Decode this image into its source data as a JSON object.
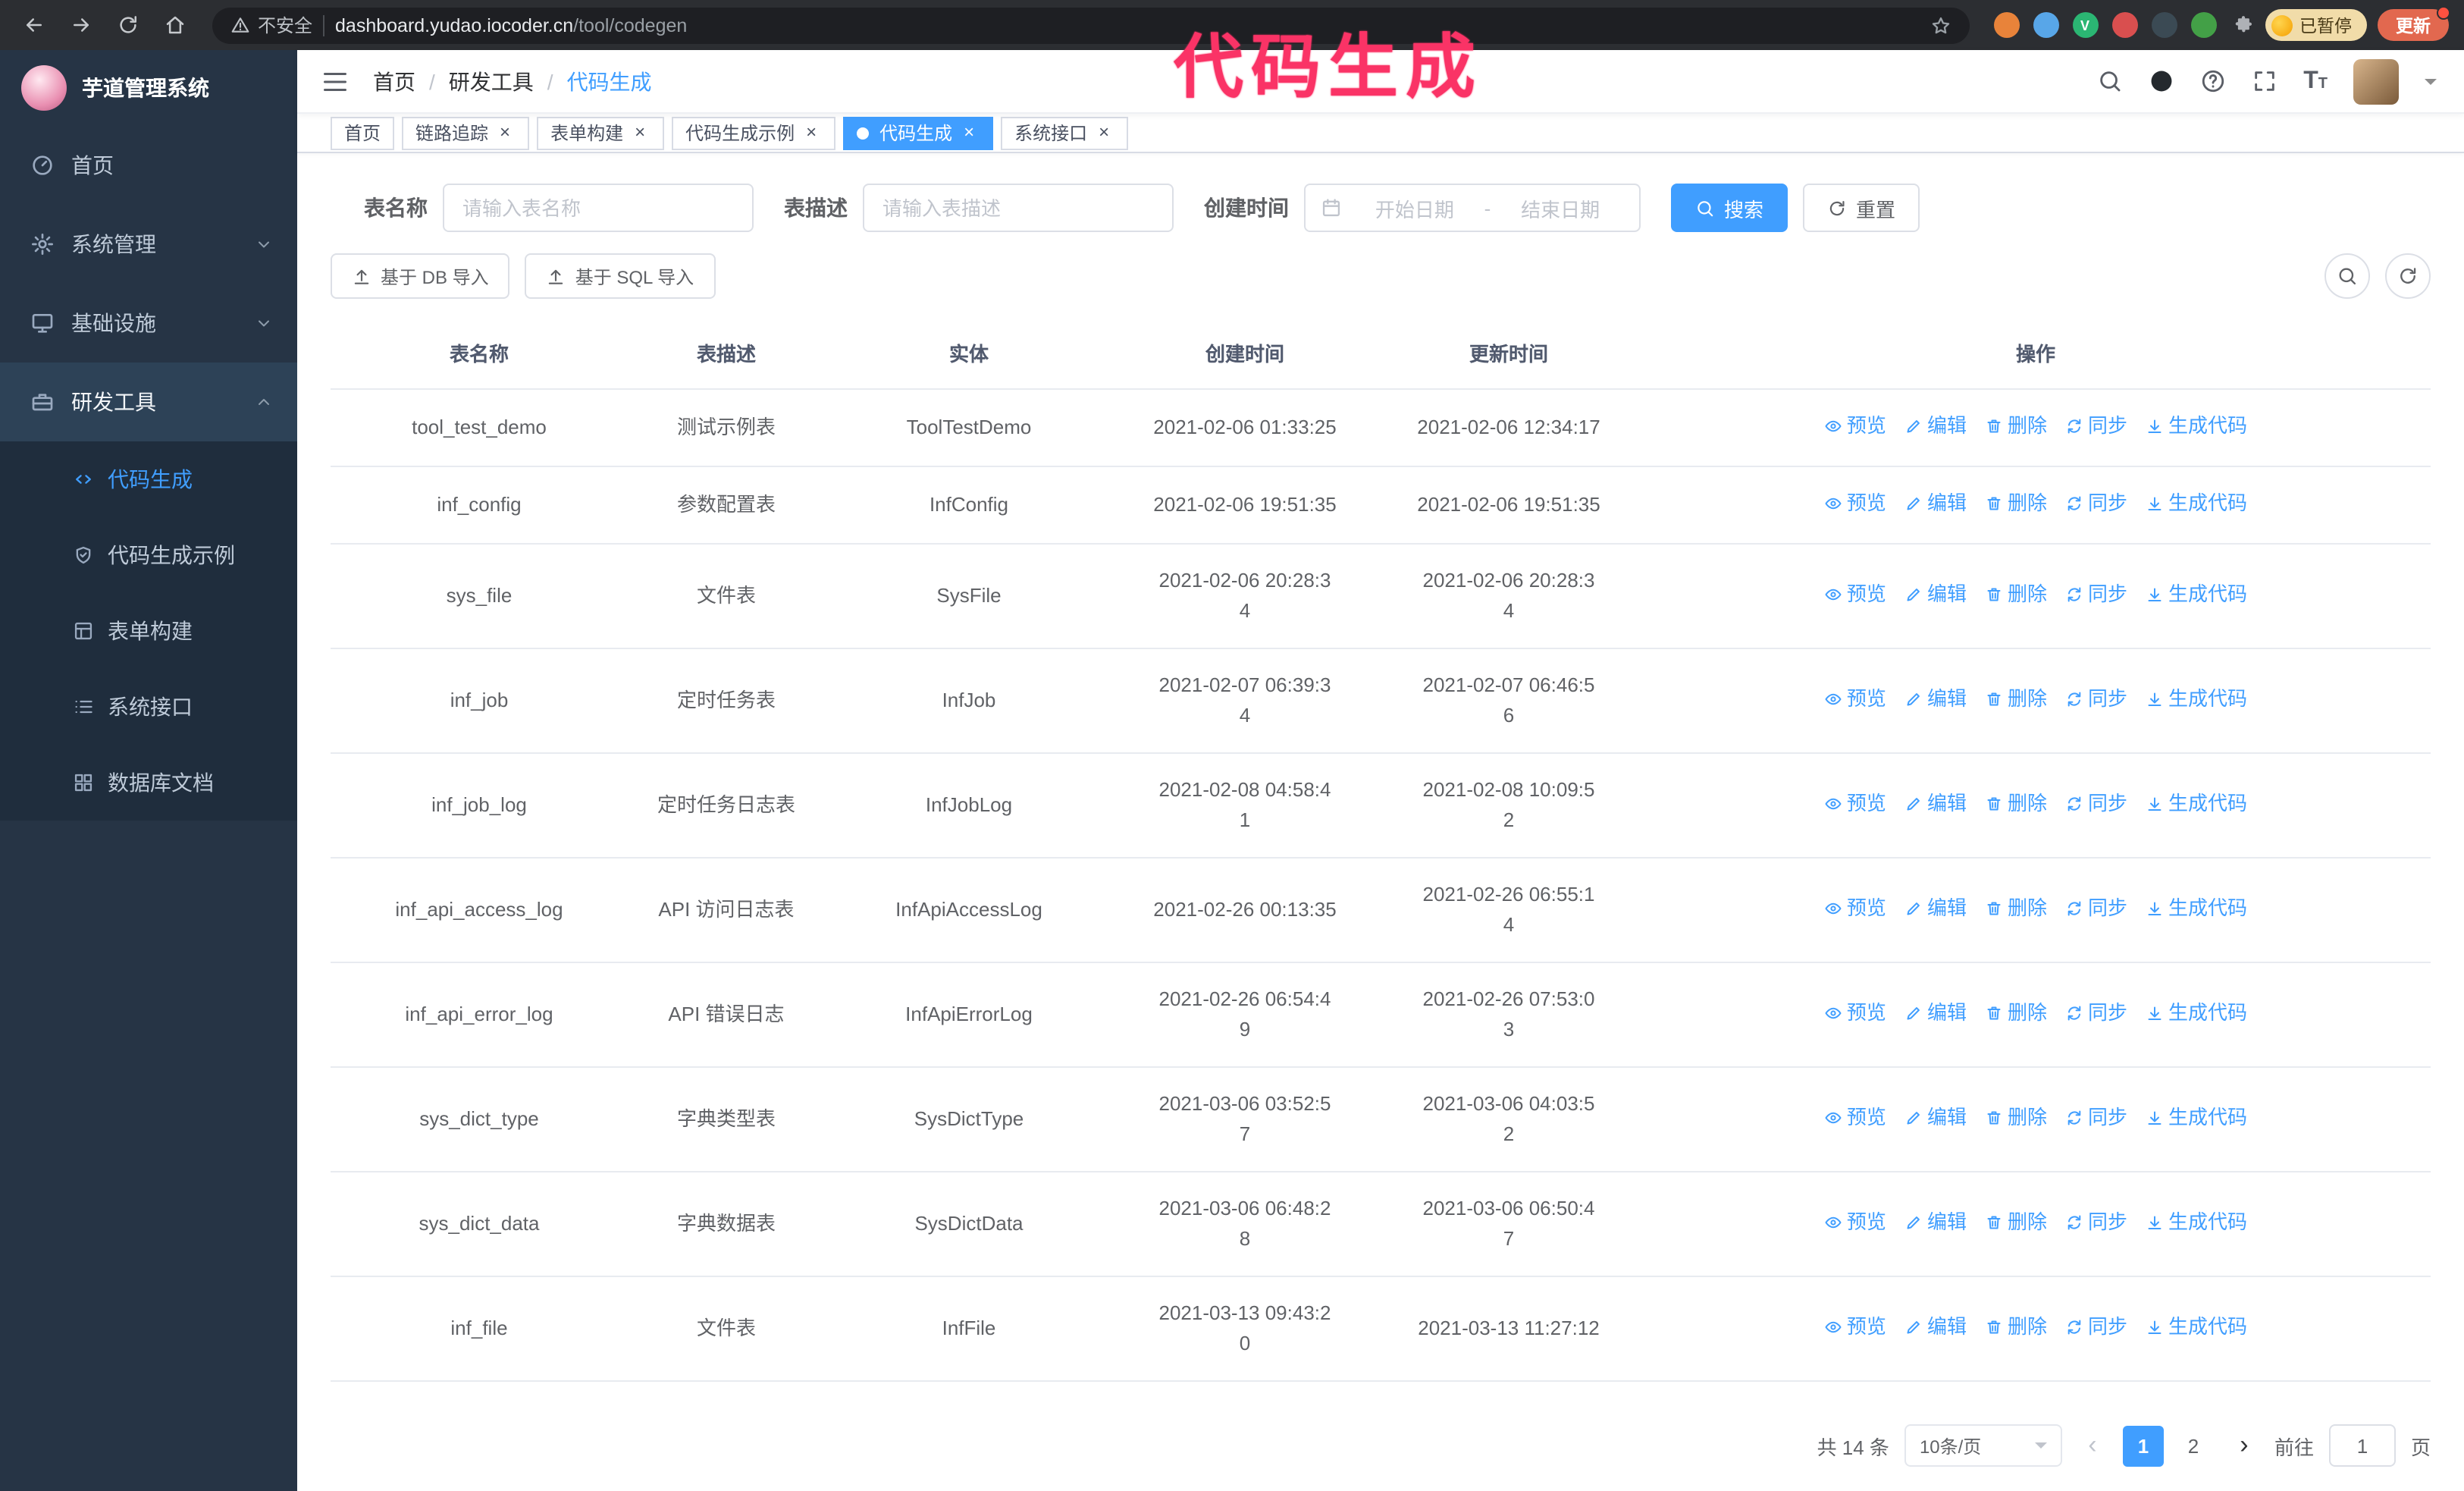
{
  "annotation": {
    "text": "代码生成"
  },
  "colors": {
    "primary": "#409eff",
    "annotation": "#fa3366",
    "sidebar_bg": "#263445",
    "submenu_bg": "#1f2d3d",
    "chrome_bg": "#2c2e32",
    "update_button_bg": "#e2684f",
    "paused_badge_bg": "#f1dca9",
    "active_tab_bg": "#409eff"
  },
  "browser": {
    "security_label": "不安全",
    "url_host": "dashboard.yudao.iocoder.cn",
    "url_path": "/tool/codegen",
    "extensions": [
      {
        "name": "fox-extension-icon",
        "color": "#e8833a"
      },
      {
        "name": "blue-extension-icon",
        "color": "#58a6e8"
      },
      {
        "name": "green-v-extension-icon",
        "color": "#2bb673",
        "glyph": "V"
      },
      {
        "name": "multicolor-extension-icon",
        "color": "#d94f4f"
      },
      {
        "name": "dark-extension-icon",
        "color": "#3b4a54"
      },
      {
        "name": "leaf-extension-icon",
        "color": "#43a047"
      }
    ],
    "paused_badge": "已暂停",
    "update_button": "更新"
  },
  "sidebar": {
    "app_title": "芋道管理系统",
    "items": [
      {
        "key": "home",
        "label": "首页",
        "icon": "dashboard"
      },
      {
        "key": "system",
        "label": "系统管理",
        "icon": "gear",
        "chevron": "down"
      },
      {
        "key": "infra",
        "label": "基础设施",
        "icon": "monitor",
        "chevron": "down"
      },
      {
        "key": "devtools",
        "label": "研发工具",
        "icon": "toolbox",
        "chevron": "up",
        "active": true
      }
    ],
    "submenu": [
      {
        "key": "codegen",
        "label": "代码生成",
        "icon": "code",
        "active": true
      },
      {
        "key": "codegen-example",
        "label": "代码生成示例",
        "icon": "shield"
      },
      {
        "key": "form-builder",
        "label": "表单构建",
        "icon": "form"
      },
      {
        "key": "system-api",
        "label": "系统接口",
        "icon": "list"
      },
      {
        "key": "db-doc",
        "label": "数据库文档",
        "icon": "grid"
      }
    ]
  },
  "header": {
    "breadcrumb": [
      "首页",
      "研发工具",
      "代码生成"
    ]
  },
  "tabs": [
    {
      "label": "首页",
      "closable": false
    },
    {
      "label": "链路追踪",
      "closable": true
    },
    {
      "label": "表单构建",
      "closable": true
    },
    {
      "label": "代码生成示例",
      "closable": true
    },
    {
      "label": "代码生成",
      "closable": true,
      "active": true
    },
    {
      "label": "系统接口",
      "closable": true
    }
  ],
  "filters": {
    "table_name_label": "表名称",
    "table_name_placeholder": "请输入表名称",
    "table_desc_label": "表描述",
    "table_desc_placeholder": "请输入表描述",
    "create_time_label": "创建时间",
    "date_start_placeholder": "开始日期",
    "date_separator": "-",
    "date_end_placeholder": "结束日期",
    "search_button": "搜索",
    "reset_button": "重置"
  },
  "toolbar": {
    "import_db_button": "基于 DB 导入",
    "import_sql_button": "基于 SQL 导入"
  },
  "table": {
    "columns": [
      "表名称",
      "表描述",
      "实体",
      "创建时间",
      "更新时间",
      "操作"
    ],
    "actions": [
      {
        "name": "preview",
        "label": "预览",
        "icon": "eye"
      },
      {
        "name": "edit",
        "label": "编辑",
        "icon": "pencil"
      },
      {
        "name": "delete",
        "label": "删除",
        "icon": "trash"
      },
      {
        "name": "sync",
        "label": "同步",
        "icon": "sync"
      },
      {
        "name": "generate-code",
        "label": "生成代码",
        "icon": "download"
      }
    ],
    "rows": [
      {
        "name": "tool_test_demo",
        "desc": "测试示例表",
        "entity": "ToolTestDemo",
        "created": "2021-02-06 01:33:25",
        "updated": "2021-02-06 12:34:17"
      },
      {
        "name": "inf_config",
        "desc": "参数配置表",
        "entity": "InfConfig",
        "created": "2021-02-06 19:51:35",
        "updated": "2021-02-06 19:51:35"
      },
      {
        "name": "sys_file",
        "desc": "文件表",
        "entity": "SysFile",
        "created": "2021-02-06 20:28:3\n4",
        "updated": "2021-02-06 20:28:3\n4"
      },
      {
        "name": "inf_job",
        "desc": "定时任务表",
        "entity": "InfJob",
        "created": "2021-02-07 06:39:3\n4",
        "updated": "2021-02-07 06:46:5\n6"
      },
      {
        "name": "inf_job_log",
        "desc": "定时任务日志表",
        "entity": "InfJobLog",
        "created": "2021-02-08 04:58:4\n1",
        "updated": "2021-02-08 10:09:5\n2"
      },
      {
        "name": "inf_api_access_log",
        "desc": "API 访问日志表",
        "entity": "InfApiAccessLog",
        "created": "2021-02-26 00:13:35",
        "updated": "2021-02-26 06:55:1\n4"
      },
      {
        "name": "inf_api_error_log",
        "desc": "API 错误日志",
        "entity": "InfApiErrorLog",
        "created": "2021-02-26 06:54:4\n9",
        "updated": "2021-02-26 07:53:0\n3"
      },
      {
        "name": "sys_dict_type",
        "desc": "字典类型表",
        "entity": "SysDictType",
        "created": "2021-03-06 03:52:5\n7",
        "updated": "2021-03-06 04:03:5\n2"
      },
      {
        "name": "sys_dict_data",
        "desc": "字典数据表",
        "entity": "SysDictData",
        "created": "2021-03-06 06:48:2\n8",
        "updated": "2021-03-06 06:50:4\n7"
      },
      {
        "name": "inf_file",
        "desc": "文件表",
        "entity": "InfFile",
        "created": "2021-03-13 09:43:2\n0",
        "updated": "2021-03-13 11:27:12"
      }
    ]
  },
  "pagination": {
    "total_text": "共 14 条",
    "page_size": "10条/页",
    "pages": [
      "1",
      "2"
    ],
    "active_page": "1",
    "goto_label": "前往",
    "goto_value": "1",
    "goto_suffix": "页"
  }
}
